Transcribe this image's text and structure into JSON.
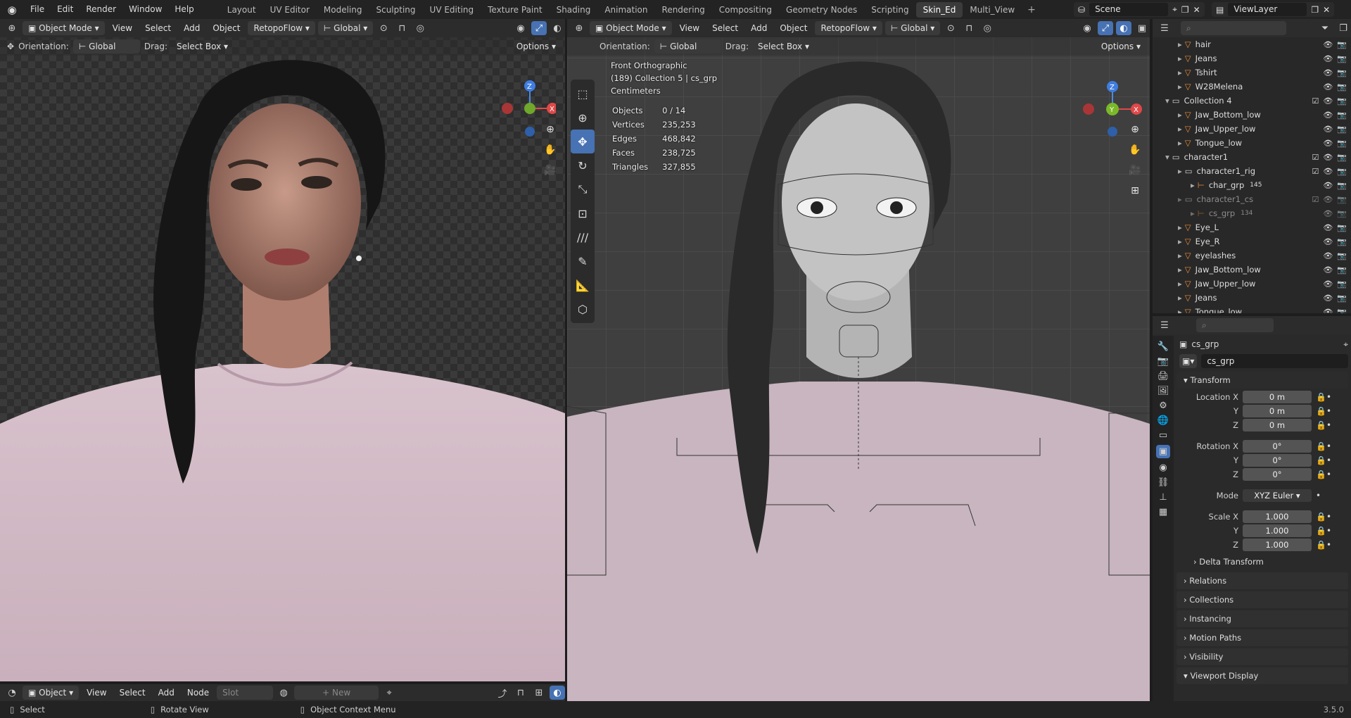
{
  "topbar": {
    "menus": [
      "File",
      "Edit",
      "Render",
      "Window",
      "Help"
    ],
    "workspaces": [
      "Layout",
      "UV Editor",
      "Modeling",
      "Sculpting",
      "UV Editing",
      "Texture Paint",
      "Shading",
      "Animation",
      "Rendering",
      "Compositing",
      "Geometry Nodes",
      "Scripting",
      "Skin_Ed",
      "Multi_View"
    ],
    "active_workspace": "Skin_Ed",
    "scene": "Scene",
    "view_layer": "ViewLayer"
  },
  "left_viewport": {
    "mode": "Object Mode",
    "menus": [
      "View",
      "Select",
      "Add",
      "Object"
    ],
    "addon": "RetopoFlow",
    "transform": "Global",
    "orientation_label": "Orientation:",
    "orientation": "Global",
    "drag_label": "Drag:",
    "drag": "Select Box",
    "options": "Options"
  },
  "right_viewport": {
    "mode": "Object Mode",
    "menus": [
      "View",
      "Select",
      "Add",
      "Object"
    ],
    "addon": "RetopoFlow",
    "transform": "Global",
    "orientation_label": "Orientation:",
    "orientation": "Global",
    "drag_label": "Drag:",
    "drag": "Select Box",
    "options": "Options",
    "overlay_info": [
      "Front Orthographic",
      "(189) Collection 5 | cs_grp",
      "Centimeters"
    ],
    "stats": [
      {
        "label": "Objects",
        "value": "0 / 14"
      },
      {
        "label": "Vertices",
        "value": "235,253"
      },
      {
        "label": "Edges",
        "value": "468,842"
      },
      {
        "label": "Faces",
        "value": "238,725"
      },
      {
        "label": "Triangles",
        "value": "327,855"
      }
    ]
  },
  "node_editor": {
    "object": "Object",
    "menus": [
      "View",
      "Select",
      "Add",
      "Node"
    ],
    "slot": "Slot",
    "new": "New"
  },
  "outliner": {
    "rows": [
      {
        "name": "hair",
        "indent": 2,
        "type": "mesh"
      },
      {
        "name": "Jeans",
        "indent": 2,
        "type": "mesh"
      },
      {
        "name": "Tshirt",
        "indent": 2,
        "type": "mesh"
      },
      {
        "name": "W28Melena",
        "indent": 2,
        "type": "mesh"
      },
      {
        "name": "Collection 4",
        "indent": 1,
        "type": "collection"
      },
      {
        "name": "Jaw_Bottom_low",
        "indent": 2,
        "type": "mesh"
      },
      {
        "name": "Jaw_Upper_low",
        "indent": 2,
        "type": "mesh"
      },
      {
        "name": "Tongue_low",
        "indent": 2,
        "type": "mesh"
      },
      {
        "name": "character1",
        "indent": 1,
        "type": "collection"
      },
      {
        "name": "character1_rig",
        "indent": 2,
        "type": "collection"
      },
      {
        "name": "char_grp",
        "indent": 3,
        "type": "empty",
        "badge": "145"
      },
      {
        "name": "character1_cs",
        "indent": 2,
        "type": "collection",
        "dim": true
      },
      {
        "name": "cs_grp",
        "indent": 3,
        "type": "empty",
        "badge": "134",
        "dim": true
      },
      {
        "name": "Eye_L",
        "indent": 2,
        "type": "mesh"
      },
      {
        "name": "Eye_R",
        "indent": 2,
        "type": "mesh"
      },
      {
        "name": "eyelashes",
        "indent": 2,
        "type": "mesh"
      },
      {
        "name": "Jaw_Bottom_low",
        "indent": 2,
        "type": "mesh"
      },
      {
        "name": "Jaw_Upper_low",
        "indent": 2,
        "type": "mesh"
      },
      {
        "name": "Jeans",
        "indent": 2,
        "type": "mesh"
      },
      {
        "name": "Tongue_low",
        "indent": 2,
        "type": "mesh"
      }
    ]
  },
  "properties": {
    "title": "cs_grp",
    "object_name": "cs_grp",
    "transform_label": "Transform",
    "location_x_label": "Location X",
    "y_label": "Y",
    "z_label": "Z",
    "location": [
      "0 m",
      "0 m",
      "0 m"
    ],
    "rotation_x_label": "Rotation X",
    "rotation": [
      "0°",
      "0°",
      "0°"
    ],
    "mode_label": "Mode",
    "mode": "XYZ Euler",
    "scale_x_label": "Scale X",
    "scale": [
      "1.000",
      "1.000",
      "1.000"
    ],
    "delta": "Delta Transform",
    "panels": [
      "Relations",
      "Collections",
      "Instancing",
      "Motion Paths",
      "Visibility",
      "Viewport Display"
    ]
  },
  "statusbar": {
    "select": "Select",
    "rotate": "Rotate View",
    "context": "Object Context Menu",
    "version": "3.5.0"
  }
}
